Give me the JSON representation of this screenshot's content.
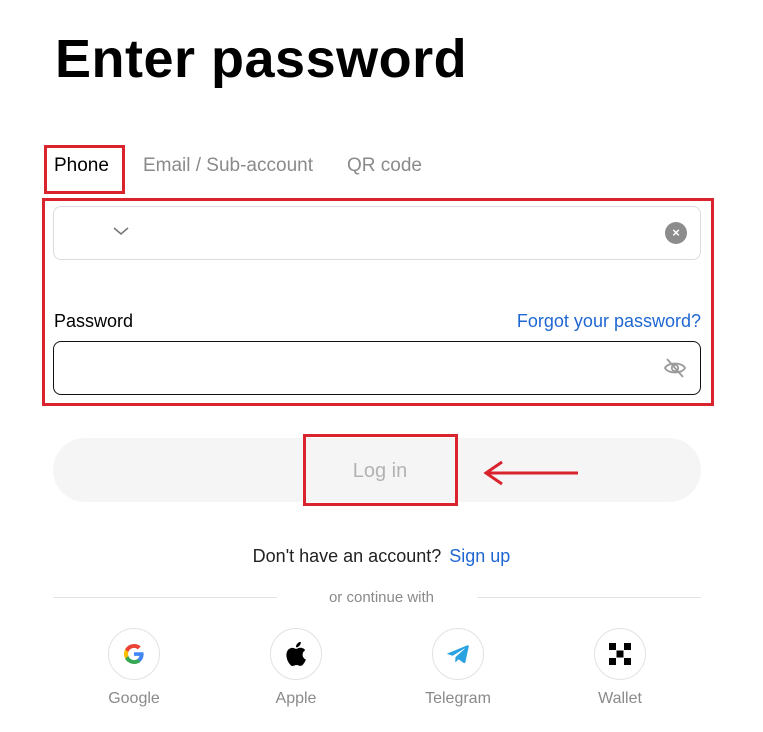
{
  "header": {
    "title": "Enter password"
  },
  "tabs": [
    {
      "label": "Phone",
      "active": true
    },
    {
      "label": "Email / Sub-account",
      "active": false
    },
    {
      "label": "QR code",
      "active": false
    }
  ],
  "form": {
    "phone_value": "",
    "password_label": "Password",
    "forgot_label": "Forgot your password?",
    "password_value": ""
  },
  "actions": {
    "login_label": "Log in"
  },
  "signup": {
    "prompt": "Don't have an account?",
    "link": "Sign up"
  },
  "divider": {
    "text": "or continue with"
  },
  "social": [
    {
      "label": "Google",
      "icon": "google-icon"
    },
    {
      "label": "Apple",
      "icon": "apple-icon"
    },
    {
      "label": "Telegram",
      "icon": "telegram-icon"
    },
    {
      "label": "Wallet",
      "icon": "wallet-icon"
    }
  ],
  "colors": {
    "accent": "#1f67d2",
    "annotation": "#d9232d",
    "disabled_button": "#f5f5f5"
  }
}
